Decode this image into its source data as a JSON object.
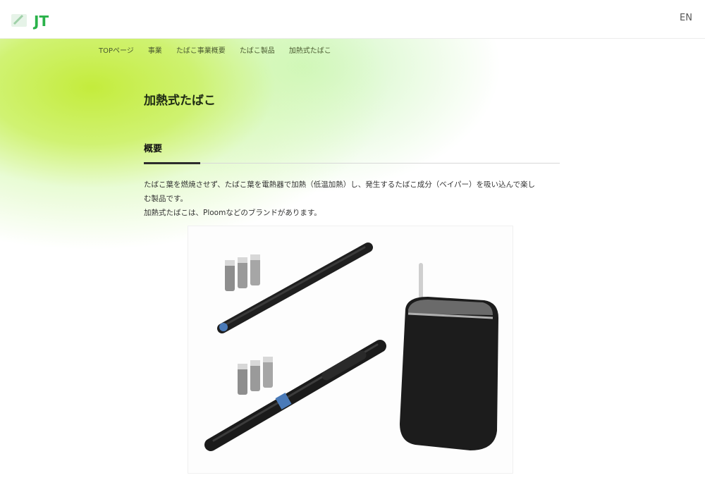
{
  "header": {
    "logo_text": "JT",
    "logo_alt": "JT logo",
    "lang_label": "EN"
  },
  "breadcrumb": {
    "items": [
      "TOPページ",
      "事業",
      "たばこ事業概要",
      "たばこ製品",
      "加熱式たばこ"
    ]
  },
  "page": {
    "title": "加熱式たばこ",
    "section_title": "概要",
    "description_line1": "たばこ葉を燃焼させず、たばこ葉を電熱器で加熱（低温加熱）し、発生するたばこ成分（ベイパー）を吸い込んで楽しむ製品です。",
    "description_line2": "加熱式たばこは、Ploomなどのブランドがあります。"
  },
  "image": {
    "icon": "heated-tobacco-products-image",
    "colors": {
      "device": "#1f1f1f",
      "accent_blue": "#4a7ab8",
      "cartridge": "#9a9a9a"
    }
  },
  "colors": {
    "brand_green": "#2ab24a",
    "brand_lime": "#c4ec3c"
  }
}
